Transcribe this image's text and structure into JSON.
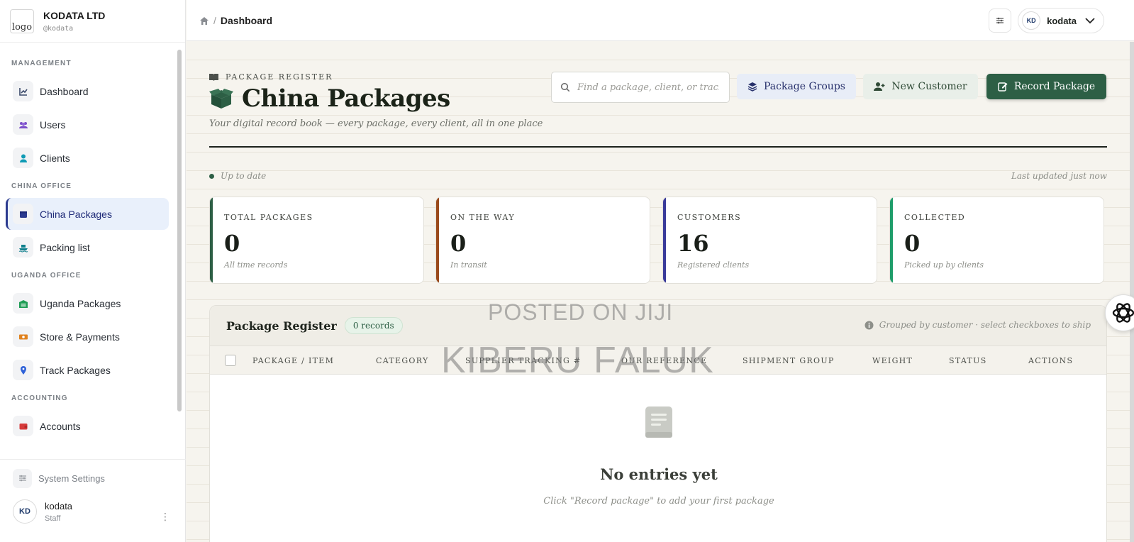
{
  "brand": {
    "logo_alt": "logo",
    "name": "KODATA LTD",
    "handle": "@kodata"
  },
  "sidebar": {
    "sections": [
      {
        "title": "MANAGEMENT",
        "items": [
          {
            "label": "Dashboard",
            "icon": "chart-line-icon",
            "color": "#3b4a6b"
          },
          {
            "label": "Users",
            "icon": "users-icon",
            "color": "#7b4fc9"
          },
          {
            "label": "Clients",
            "icon": "user-icon",
            "color": "#0f9bb5"
          }
        ]
      },
      {
        "title": "CHINA OFFICE",
        "items": [
          {
            "label": "China Packages",
            "icon": "box-icon",
            "color": "#2b3a8f",
            "active": true
          },
          {
            "label": "Packing list",
            "icon": "ship-icon",
            "color": "#0f7f8c"
          }
        ]
      },
      {
        "title": "UGANDA OFFICE",
        "items": [
          {
            "label": "Uganda Packages",
            "icon": "warehouse-icon",
            "color": "#1f9d55"
          },
          {
            "label": "Store & Payments",
            "icon": "money-icon",
            "color": "#e0821f"
          },
          {
            "label": "Track Packages",
            "icon": "map-pin-icon",
            "color": "#2f62d8"
          }
        ]
      },
      {
        "title": "ACCOUNTING",
        "items": [
          {
            "label": "Accounts",
            "icon": "wallet-icon",
            "color": "#d63a3a"
          }
        ]
      }
    ],
    "system_settings": "System Settings",
    "user": {
      "name": "kodata",
      "role": "Staff",
      "avatar_text": "KD"
    }
  },
  "topbar": {
    "breadcrumb_current": "Dashboard",
    "breadcrumb_sep": "/",
    "user_name": "kodata",
    "avatar_text": "KD"
  },
  "header": {
    "eyebrow": "PACKAGE REGISTER",
    "title": "China Packages",
    "subtitle": "Your digital record book — every package, every client, all in one place",
    "search_placeholder": "Find a package, client, or tracking #",
    "btn_groups": "Package Groups",
    "btn_customer": "New Customer",
    "btn_record": "Record Package"
  },
  "status": {
    "left": "Up to date",
    "right": "Last updated just now"
  },
  "stats": [
    {
      "label": "TOTAL PACKAGES",
      "value": "0",
      "sub": "All time records",
      "color": "#2d5f45"
    },
    {
      "label": "ON THE WAY",
      "value": "0",
      "sub": "In transit",
      "color": "#9a4a1c"
    },
    {
      "label": "CUSTOMERS",
      "value": "16",
      "sub": "Registered clients",
      "color": "#3a3b9a"
    },
    {
      "label": "COLLECTED",
      "value": "0",
      "sub": "Picked up by clients",
      "color": "#1f9d6a"
    }
  ],
  "register": {
    "title": "Package Register",
    "count_badge": "0 records",
    "note": "Grouped by customer · select checkboxes to ship",
    "columns": [
      "PACKAGE / ITEM",
      "CATEGORY",
      "SUPPLIER TRACKING #",
      "OUR REFERENCE",
      "SHIPMENT GROUP",
      "WEIGHT",
      "STATUS",
      "ACTIONS"
    ],
    "empty_title": "No entries yet",
    "empty_hint": "Click \"Record package\" to add your first package"
  },
  "watermark": {
    "line1": "POSTED ON JIJI",
    "line2": "KIBERU FALUK"
  }
}
